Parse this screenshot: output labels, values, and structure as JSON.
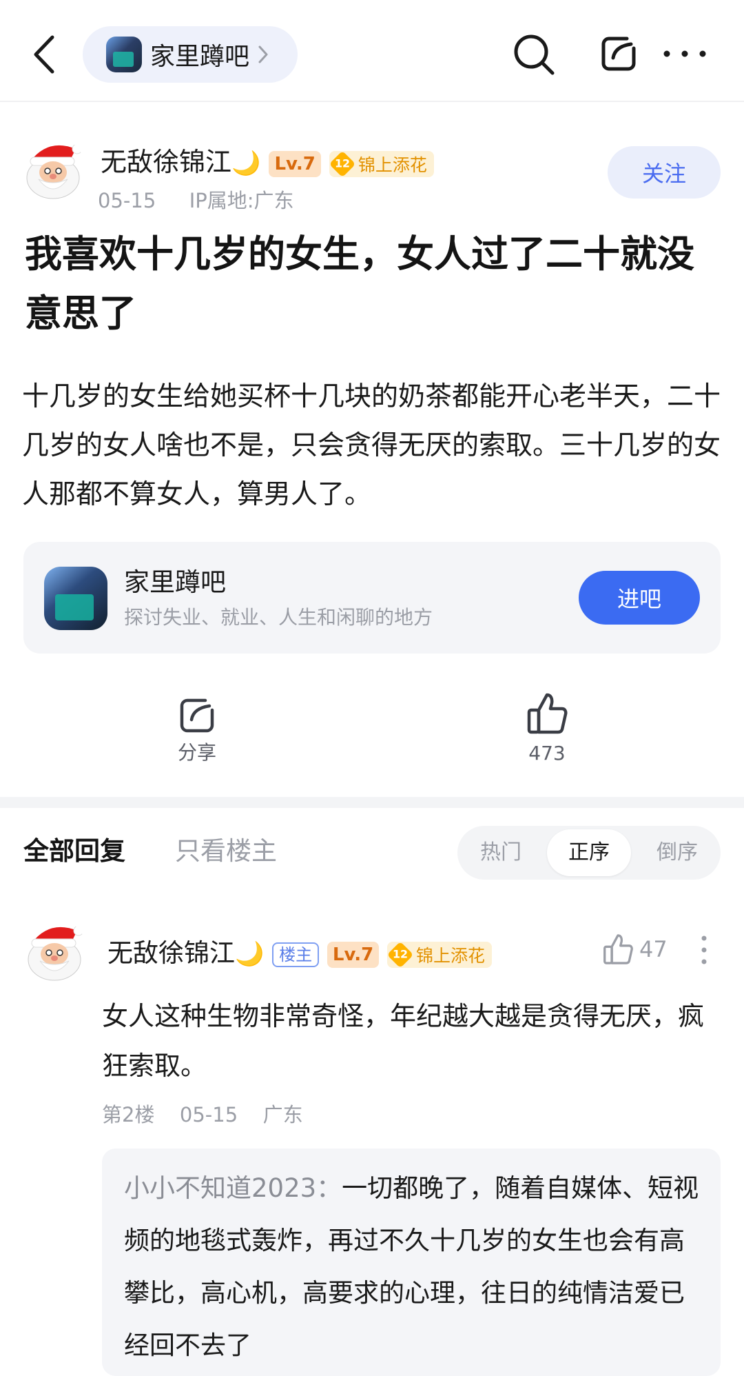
{
  "topbar": {
    "forum_name": "家里蹲吧"
  },
  "post": {
    "author": "无敌徐锦江",
    "author_emoji": "🌙",
    "level": "Lv.7",
    "honor_level": "12",
    "honor_title": "锦上添花",
    "date": "05-15",
    "ip_location": "IP属地:广东",
    "follow_label": "关注",
    "title": "我喜欢十几岁的女生，女人过了二十就没意思了",
    "body": "十几岁的女生给她买杯十几块的奶茶都能开心老半天，二十几岁的女人啥也不是，只会贪得无厌的索取。三十几岁的女人那都不算女人，算男人了。"
  },
  "forum_card": {
    "name": "家里蹲吧",
    "description": "探讨失业、就业、人生和闲聊的地方",
    "enter_label": "进吧"
  },
  "actions": {
    "share_label": "分享",
    "like_count": "473"
  },
  "reply_tabs": {
    "all": "全部回复",
    "owner_only": "只看楼主",
    "sort": [
      "热门",
      "正序",
      "倒序"
    ],
    "sort_selected": "正序"
  },
  "reply": {
    "author": "无敌徐锦江",
    "author_emoji": "🌙",
    "owner_badge": "楼主",
    "level": "Lv.7",
    "honor_level": "12",
    "honor_title": "锦上添花",
    "like_count": "47",
    "body": "女人这种生物非常奇怪，年纪越大越是贪得无厌，疯狂索取。",
    "floor": "第2楼",
    "date": "05-15",
    "location": "广东",
    "sub_reply": {
      "author": "小小不知道2023：",
      "text": "一切都晚了，随着自媒体、短视频的地毯式轰炸，再过不久十几岁的女生也会有高攀比，高心机，高要求的心理，往日的纯情洁爱已经回不去了"
    }
  },
  "colors": {
    "accent": "#3b6bf2",
    "follow_bg": "#eaeefb",
    "level_badge": "#fde1c4",
    "honor_badge": "#fdf1d5"
  }
}
